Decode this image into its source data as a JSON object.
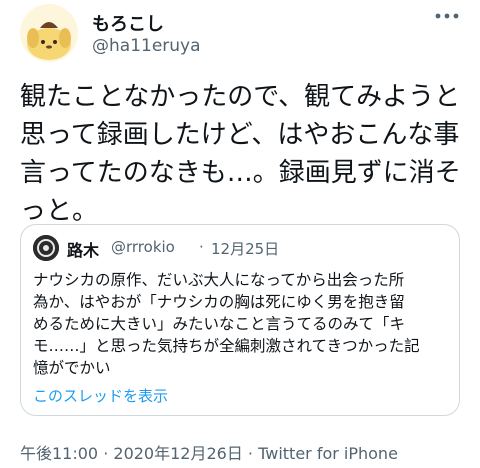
{
  "author": {
    "display_name": "もろこし",
    "handle": "@ha11eruya"
  },
  "tweet": {
    "lines": [
      "観たことなかったので、観てみようと",
      "思って録画したけど、はやおこんな事",
      "言ってたのなきも…。録画見ずに消そ",
      "っと。"
    ]
  },
  "quoted_tweet": {
    "display_name": "路木",
    "handle": "@rrrokio",
    "separator": "·",
    "date": "12月25日",
    "lines": [
      "ナウシカの原作、だいぶ大人になってから出会った所",
      "為か、はやおが「ナウシカの胸は死にゆく男を抱き留",
      "めるために大きい」みたいなこと言うてるのみて「キ",
      "モ……」と思った気持ちが全編刺激されてきつかった記",
      "憶がでかい"
    ],
    "show_thread": "このスレッドを表示"
  },
  "meta": {
    "time": "午後11:00",
    "separator1": " · ",
    "date": "2020年12月26日",
    "separator2": " · ",
    "source": "Twitter for iPhone"
  },
  "colors": {
    "link": "#1d9bf0",
    "secondary_text": "#536471",
    "border": "#cfd9de"
  },
  "icons": {
    "more": "more-horizontal-icon",
    "avatar": "pompompurin-avatar",
    "quote_avatar": "quote-author-avatar"
  }
}
